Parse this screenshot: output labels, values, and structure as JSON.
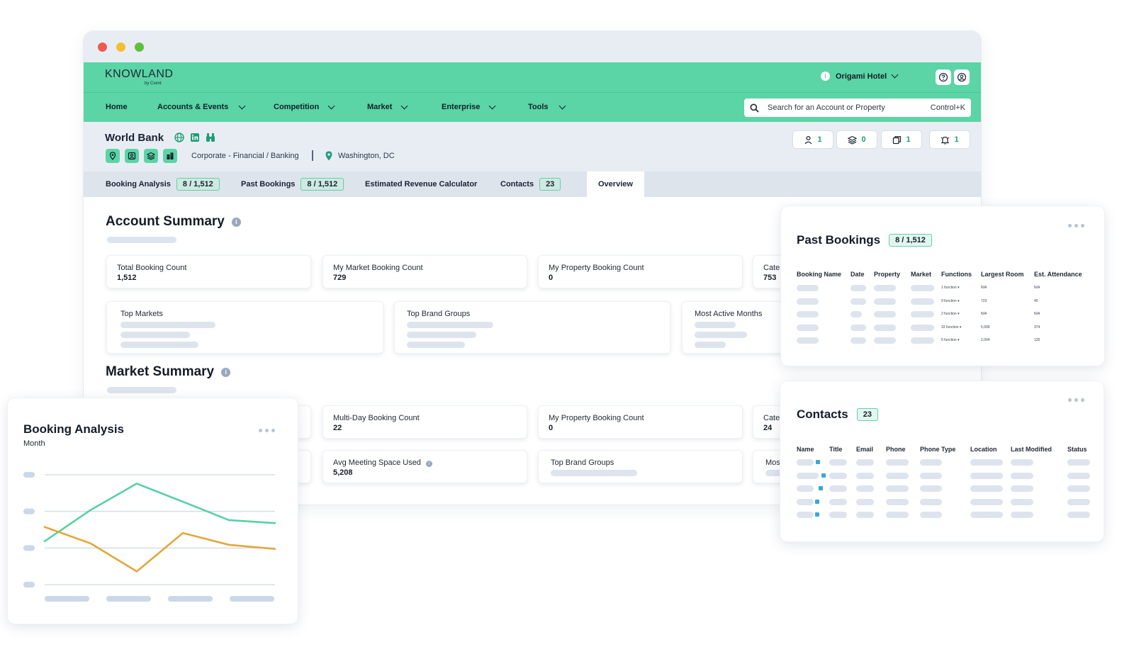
{
  "app": {
    "logo": "KNOWLAND",
    "logo_sub": "by Cvent",
    "hotel": "Origami Hotel"
  },
  "nav": {
    "home": "Home",
    "accounts": "Accounts & Events",
    "competition": "Competition",
    "market": "Market",
    "enterprise": "Enterprise",
    "tools": "Tools"
  },
  "search": {
    "placeholder": "Search for an Account or Property",
    "shortcut": "Control+K"
  },
  "account": {
    "name": "World Bank",
    "category": "Corporate  - Financial / Banking",
    "location": "Washington, DC",
    "counters": {
      "people": "1",
      "layers": "0",
      "copies": "1",
      "alerts": "1"
    }
  },
  "tabs": {
    "booking_analysis": "Booking Analysis",
    "booking_analysis_badge": "8 / 1,512",
    "past_bookings": "Past Bookings",
    "past_bookings_badge": "8 / 1,512",
    "revenue_calc": "Estimated Revenue Calculator",
    "contacts": "Contacts",
    "contacts_badge": "23",
    "overview": "Overview"
  },
  "account_summary": {
    "title": "Account Summary",
    "info": "i",
    "stats": [
      {
        "label": "Total Booking Count",
        "value": "1,512"
      },
      {
        "label": "My Market Booking Count",
        "value": "729"
      },
      {
        "label": "My Property Booking Count",
        "value": "0"
      },
      {
        "label": "Cate",
        "value": "753"
      }
    ],
    "groups": [
      "Top Markets",
      "Top Brand Groups",
      "Most Active Months"
    ]
  },
  "market_summary": {
    "title": "Market Summary",
    "info": "i",
    "stats": [
      {
        "label": "Multi-Day Booking Count",
        "value": "22"
      },
      {
        "label": "My Property Booking Count",
        "value": "0"
      },
      {
        "label": "Cate",
        "value": "24"
      },
      {
        "label": "Avg Meeting Space Used",
        "value": "5,208"
      },
      {
        "label": "Top Brand Groups",
        "value": ""
      },
      {
        "label": "Mos",
        "value": ""
      }
    ]
  },
  "booking_panel": {
    "title": "Booking Analysis",
    "subtitle": "Month"
  },
  "past_bookings_panel": {
    "title": "Past Bookings",
    "badge": "8 / 1,512",
    "columns": [
      "Booking Name",
      "Date",
      "Property",
      "Market",
      "Functions",
      "Largest Room",
      "Est. Attendance"
    ],
    "rows": [
      {
        "functions": "1 function",
        "largest_room": "N/A",
        "attendance": "N/A"
      },
      {
        "functions": "9 function",
        "largest_room": "723",
        "attendance": "45"
      },
      {
        "functions": "2 function",
        "largest_room": "N/A",
        "attendance": "N/A"
      },
      {
        "functions": "33 function",
        "largest_room": "5,999",
        "attendance": "374"
      },
      {
        "functions": "6 function",
        "largest_room": "2,004",
        "attendance": "125"
      }
    ]
  },
  "contacts_panel": {
    "title": "Contacts",
    "badge": "23",
    "columns": [
      "Name",
      "Title",
      "Email",
      "Phone",
      "Phone Type",
      "Location",
      "Last Modified",
      "Status"
    ]
  },
  "chart_data": {
    "type": "line",
    "x": [
      0,
      1,
      2,
      3,
      4,
      5
    ],
    "series": [
      {
        "values": [
          0.58,
          1.72,
          2.68,
          2.02,
          1.35,
          1.24
        ],
        "color": "#56d1a4"
      },
      {
        "values": [
          1.1,
          0.5,
          -0.52,
          0.88,
          0.45,
          0.3
        ],
        "color": "#e3a73c"
      }
    ],
    "ylim": [
      -1,
      3
    ],
    "grid": true,
    "legend": "none",
    "colors": {
      "green": "#56d1a4",
      "orange": "#e3a73c"
    }
  }
}
